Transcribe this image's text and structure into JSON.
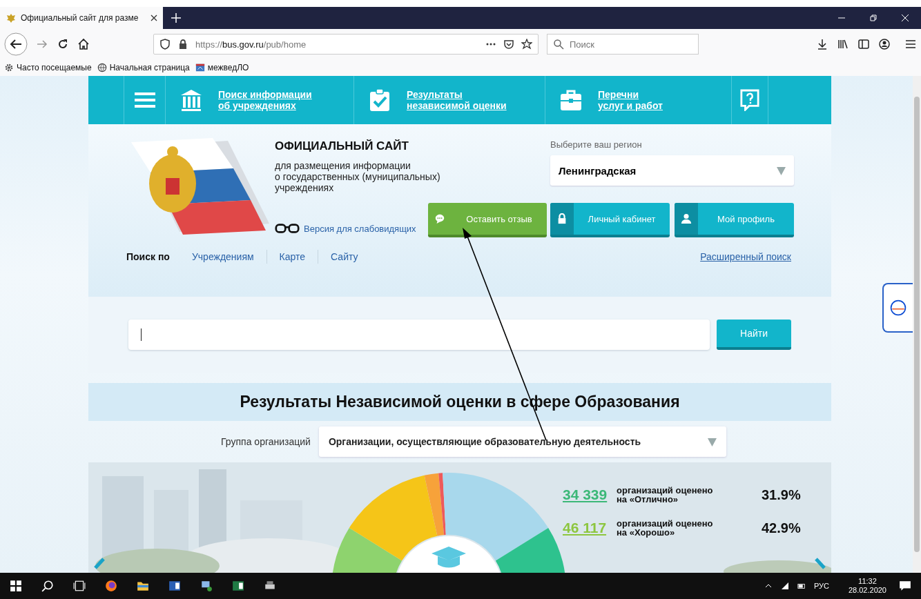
{
  "browser": {
    "tab_title": "Официальный сайт для разме",
    "url_scheme": "https://",
    "url_host": "bus.gov.ru",
    "url_path": "/pub/home",
    "search_placeholder": "Поиск",
    "bookmarks": [
      {
        "label": "Часто посещаемые"
      },
      {
        "label": "Начальная страница"
      },
      {
        "label": "межведЛО"
      }
    ]
  },
  "nav": [
    {
      "lines": [
        "Поиск информации",
        "об учреждениях"
      ]
    },
    {
      "lines": [
        "Результаты",
        "независимой оценки"
      ]
    },
    {
      "lines": [
        "Перечни",
        "услуг и работ"
      ]
    }
  ],
  "header": {
    "title": "ОФИЦИАЛЬНЫЙ САЙТ",
    "subtitle_lines": [
      "для размещения информации",
      "о государственных (муниципальных)",
      "учреждениях"
    ],
    "low_vision_link": "Версия для слабовидящих",
    "region_label": "Выберите ваш регион",
    "region_value": "Ленинградская",
    "buttons": [
      {
        "label": "Оставить отзыв",
        "kind": "feedback"
      },
      {
        "label": "Личный кабинет",
        "kind": "cabinet"
      },
      {
        "label": "Мой профиль",
        "kind": "profile"
      }
    ]
  },
  "search": {
    "by_label": "Поиск по",
    "by_links": [
      "Учреждениям",
      "Карте",
      "Сайту"
    ],
    "advanced_link": "Расширенный поиск",
    "button": "Найти"
  },
  "results": {
    "title": "Результаты Независимой оценки в сфере Образования",
    "group_label": "Группа организаций",
    "group_value": "Организации, осуществляющие образовательную деятельность",
    "legend": [
      {
        "count": "34 339",
        "lines": [
          "организаций оценено",
          "на «Отлично»"
        ],
        "percent": "31.9%",
        "color": "#3cb878"
      },
      {
        "count": "46 117",
        "lines": [
          "организаций оценено",
          "на «Хорошо»"
        ],
        "percent": "42.9%",
        "color": "#8dc63f"
      }
    ]
  },
  "taskbar": {
    "language": "РУС",
    "time": "11:32",
    "date": "28.02.2020"
  }
}
